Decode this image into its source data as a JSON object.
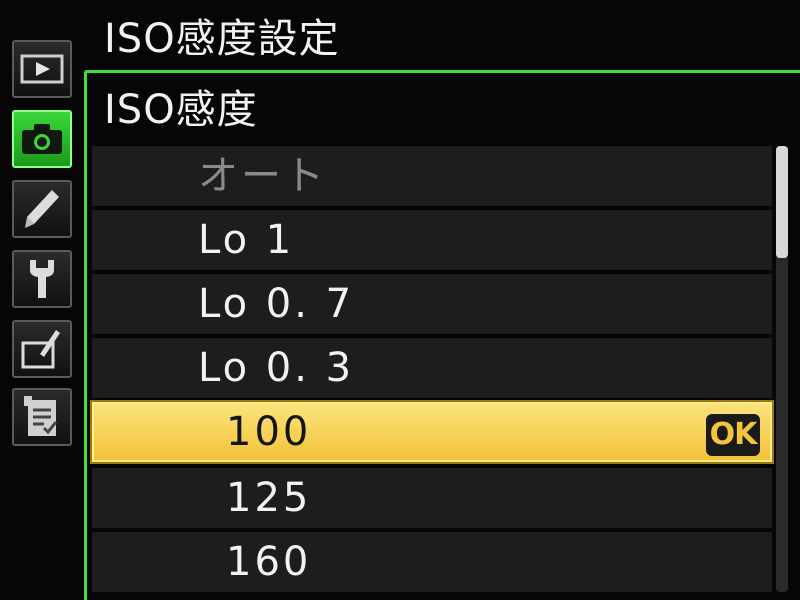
{
  "menu": {
    "title": "ISO感度設定",
    "tabs": [
      {
        "name": "playback",
        "icon": "play-icon",
        "active": false
      },
      {
        "name": "shooting",
        "icon": "camera-icon",
        "active": true
      },
      {
        "name": "custom-settings",
        "icon": "pencil-icon",
        "active": false
      },
      {
        "name": "setup",
        "icon": "wrench-icon",
        "active": false
      },
      {
        "name": "retouch",
        "icon": "retouch-brush-icon",
        "active": false
      },
      {
        "name": "my-menu",
        "icon": "recent-settings-icon",
        "active": false
      }
    ]
  },
  "submenu": {
    "title": "ISO感度",
    "items": [
      {
        "label": "オート",
        "state": "disabled"
      },
      {
        "label": "Lo 1",
        "state": "normal"
      },
      {
        "label": "Lo 0. 7",
        "state": "normal"
      },
      {
        "label": "Lo 0. 3",
        "state": "normal"
      },
      {
        "label": "100",
        "state": "selected"
      },
      {
        "label": "125",
        "state": "normal"
      },
      {
        "label": "160",
        "state": "normal"
      }
    ],
    "ok_badge": "OK"
  },
  "colors": {
    "active_tab": "#2ec82e",
    "panel_border": "#3ee03e",
    "selection": "#f6cf48"
  }
}
